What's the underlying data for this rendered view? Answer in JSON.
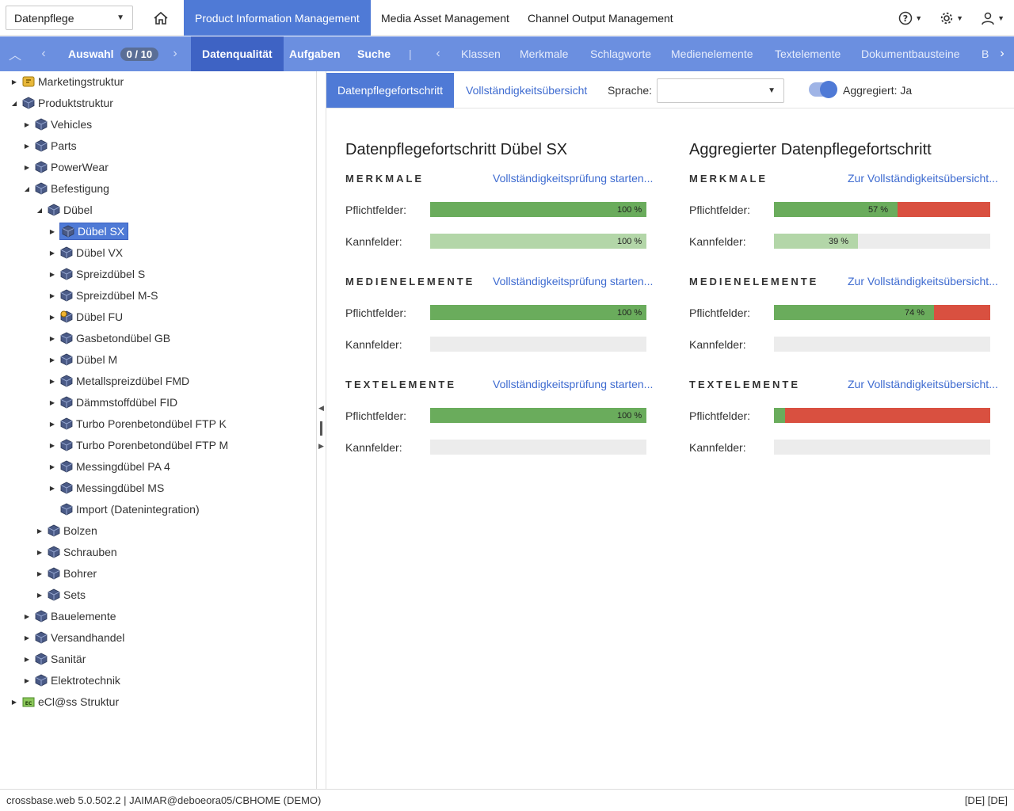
{
  "topbar": {
    "module_select": "Datenpflege",
    "tabs": [
      "Product Information Management",
      "Media Asset Management",
      "Channel Output Management"
    ],
    "icons": [
      "help-icon",
      "gear-icon",
      "user-icon"
    ]
  },
  "navbar": {
    "selection_label": "Auswahl",
    "selection_count": "0 / 10",
    "items_primary": [
      "Datenqualität",
      "Aufgaben",
      "Suche"
    ],
    "separator": "|",
    "items_secondary": [
      "Klassen",
      "Merkmale",
      "Schlagworte",
      "Medienelemente",
      "Textelemente",
      "Dokumentbausteine",
      "B"
    ]
  },
  "tree": [
    {
      "label": "Marketingstruktur",
      "level": 0,
      "toggle": "collapsed",
      "icon": "marketing-icon"
    },
    {
      "label": "Produktstruktur",
      "level": 0,
      "toggle": "expanded",
      "icon": "cube-icon"
    },
    {
      "label": "Vehicles",
      "level": 1,
      "toggle": "collapsed",
      "icon": "cube-icon"
    },
    {
      "label": "Parts",
      "level": 1,
      "toggle": "collapsed",
      "icon": "cube-icon"
    },
    {
      "label": "PowerWear",
      "level": 1,
      "toggle": "collapsed",
      "icon": "cube-icon"
    },
    {
      "label": "Befestigung",
      "level": 1,
      "toggle": "expanded",
      "icon": "cube-icon"
    },
    {
      "label": "Dübel",
      "level": 2,
      "toggle": "expanded",
      "icon": "cube-icon"
    },
    {
      "label": "Dübel SX",
      "level": 3,
      "toggle": "collapsed",
      "icon": "cube-icon",
      "selected": true
    },
    {
      "label": "Dübel VX",
      "level": 3,
      "toggle": "collapsed",
      "icon": "cube-icon"
    },
    {
      "label": "Spreizdübel S",
      "level": 3,
      "toggle": "collapsed",
      "icon": "cube-icon"
    },
    {
      "label": "Spreizdübel M-S",
      "level": 3,
      "toggle": "collapsed",
      "icon": "cube-icon"
    },
    {
      "label": "Dübel FU",
      "level": 3,
      "toggle": "collapsed",
      "icon": "cube-warning-icon"
    },
    {
      "label": "Gasbetondübel GB",
      "level": 3,
      "toggle": "collapsed",
      "icon": "cube-icon"
    },
    {
      "label": "Dübel M",
      "level": 3,
      "toggle": "collapsed",
      "icon": "cube-icon"
    },
    {
      "label": "Metallspreizdübel FMD",
      "level": 3,
      "toggle": "collapsed",
      "icon": "cube-icon"
    },
    {
      "label": "Dämmstoffdübel FID",
      "level": 3,
      "toggle": "collapsed",
      "icon": "cube-icon"
    },
    {
      "label": "Turbo Porenbetondübel FTP K",
      "level": 3,
      "toggle": "collapsed",
      "icon": "cube-icon"
    },
    {
      "label": "Turbo Porenbetondübel FTP M",
      "level": 3,
      "toggle": "collapsed",
      "icon": "cube-icon"
    },
    {
      "label": "Messingdübel PA 4",
      "level": 3,
      "toggle": "collapsed",
      "icon": "cube-icon"
    },
    {
      "label": "Messingdübel MS",
      "level": 3,
      "toggle": "collapsed",
      "icon": "cube-icon"
    },
    {
      "label": "Import (Datenintegration)",
      "level": 3,
      "toggle": "none",
      "icon": "cube-icon"
    },
    {
      "label": "Bolzen",
      "level": 2,
      "toggle": "collapsed",
      "icon": "cube-icon"
    },
    {
      "label": "Schrauben",
      "level": 2,
      "toggle": "collapsed",
      "icon": "cube-icon"
    },
    {
      "label": "Bohrer",
      "level": 2,
      "toggle": "collapsed",
      "icon": "cube-icon"
    },
    {
      "label": "Sets",
      "level": 2,
      "toggle": "collapsed",
      "icon": "cube-icon"
    },
    {
      "label": "Bauelemente",
      "level": 1,
      "toggle": "collapsed",
      "icon": "cube-icon"
    },
    {
      "label": "Versandhandel",
      "level": 1,
      "toggle": "collapsed",
      "icon": "cube-icon"
    },
    {
      "label": "Sanitär",
      "level": 1,
      "toggle": "collapsed",
      "icon": "cube-icon"
    },
    {
      "label": "Elektrotechnik",
      "level": 1,
      "toggle": "collapsed",
      "icon": "cube-icon"
    },
    {
      "label": "eCl@ss Struktur",
      "level": 0,
      "toggle": "collapsed",
      "icon": "eclass-icon"
    }
  ],
  "subtabs": [
    "Datenpflegefortschritt",
    "Vollständigkeitsübersicht"
  ],
  "language": {
    "label": "Sprache:",
    "value": ""
  },
  "aggregate": {
    "label": "Aggregiert: Ja",
    "on": true
  },
  "colors": {
    "green": "#6aac5c",
    "light_green": "#b3d6a8",
    "red": "#d95040",
    "accent": "#4f7ad6"
  },
  "panels": [
    {
      "title": "Datenpflegefortschritt Dübel SX",
      "sections": [
        {
          "name": "MERKMALE",
          "link": "Vollständigkeitsprüfung starten...",
          "rows": [
            {
              "label": "Pflichtfelder:",
              "value": 100,
              "kind": "mandatory",
              "text": "100 %"
            },
            {
              "label": "Kannfelder:",
              "value": 100,
              "kind": "optional",
              "text": "100 %"
            }
          ]
        },
        {
          "name": "MEDIENELEMENTE",
          "link": "Vollständigkeitsprüfung starten...",
          "rows": [
            {
              "label": "Pflichtfelder:",
              "value": 100,
              "kind": "mandatory",
              "text": "100 %"
            },
            {
              "label": "Kannfelder:",
              "value": 0,
              "kind": "optional",
              "text": ""
            }
          ]
        },
        {
          "name": "TEXTELEMENTE",
          "link": "Vollständigkeitsprüfung starten...",
          "rows": [
            {
              "label": "Pflichtfelder:",
              "value": 100,
              "kind": "mandatory",
              "text": "100 %"
            },
            {
              "label": "Kannfelder:",
              "value": 0,
              "kind": "optional",
              "text": ""
            }
          ]
        }
      ]
    },
    {
      "title": "Aggregierter Datenpflegefortschritt",
      "sections": [
        {
          "name": "MERKMALE",
          "link": "Zur Vollständigkeitsübersicht...",
          "rows": [
            {
              "label": "Pflichtfelder:",
              "value": 57,
              "kind": "mandatory",
              "text": "57 %"
            },
            {
              "label": "Kannfelder:",
              "value": 39,
              "kind": "optional",
              "text": "39 %"
            }
          ]
        },
        {
          "name": "MEDIENELEMENTE",
          "link": "Zur Vollständigkeitsübersicht...",
          "rows": [
            {
              "label": "Pflichtfelder:",
              "value": 74,
              "kind": "mandatory",
              "text": "74 %"
            },
            {
              "label": "Kannfelder:",
              "value": 0,
              "kind": "optional",
              "text": ""
            }
          ]
        },
        {
          "name": "TEXTELEMENTE",
          "link": "Zur Vollständigkeitsübersicht...",
          "rows": [
            {
              "label": "Pflichtfelder:",
              "value": 5,
              "kind": "mandatory",
              "text": ""
            },
            {
              "label": "Kannfelder:",
              "value": 0,
              "kind": "optional",
              "text": ""
            }
          ]
        }
      ]
    }
  ],
  "footer": {
    "left": "crossbase.web 5.0.502.2 | JAIMAR@deboeora05/CBHOME (DEMO)",
    "right": "[DE] [DE]"
  }
}
